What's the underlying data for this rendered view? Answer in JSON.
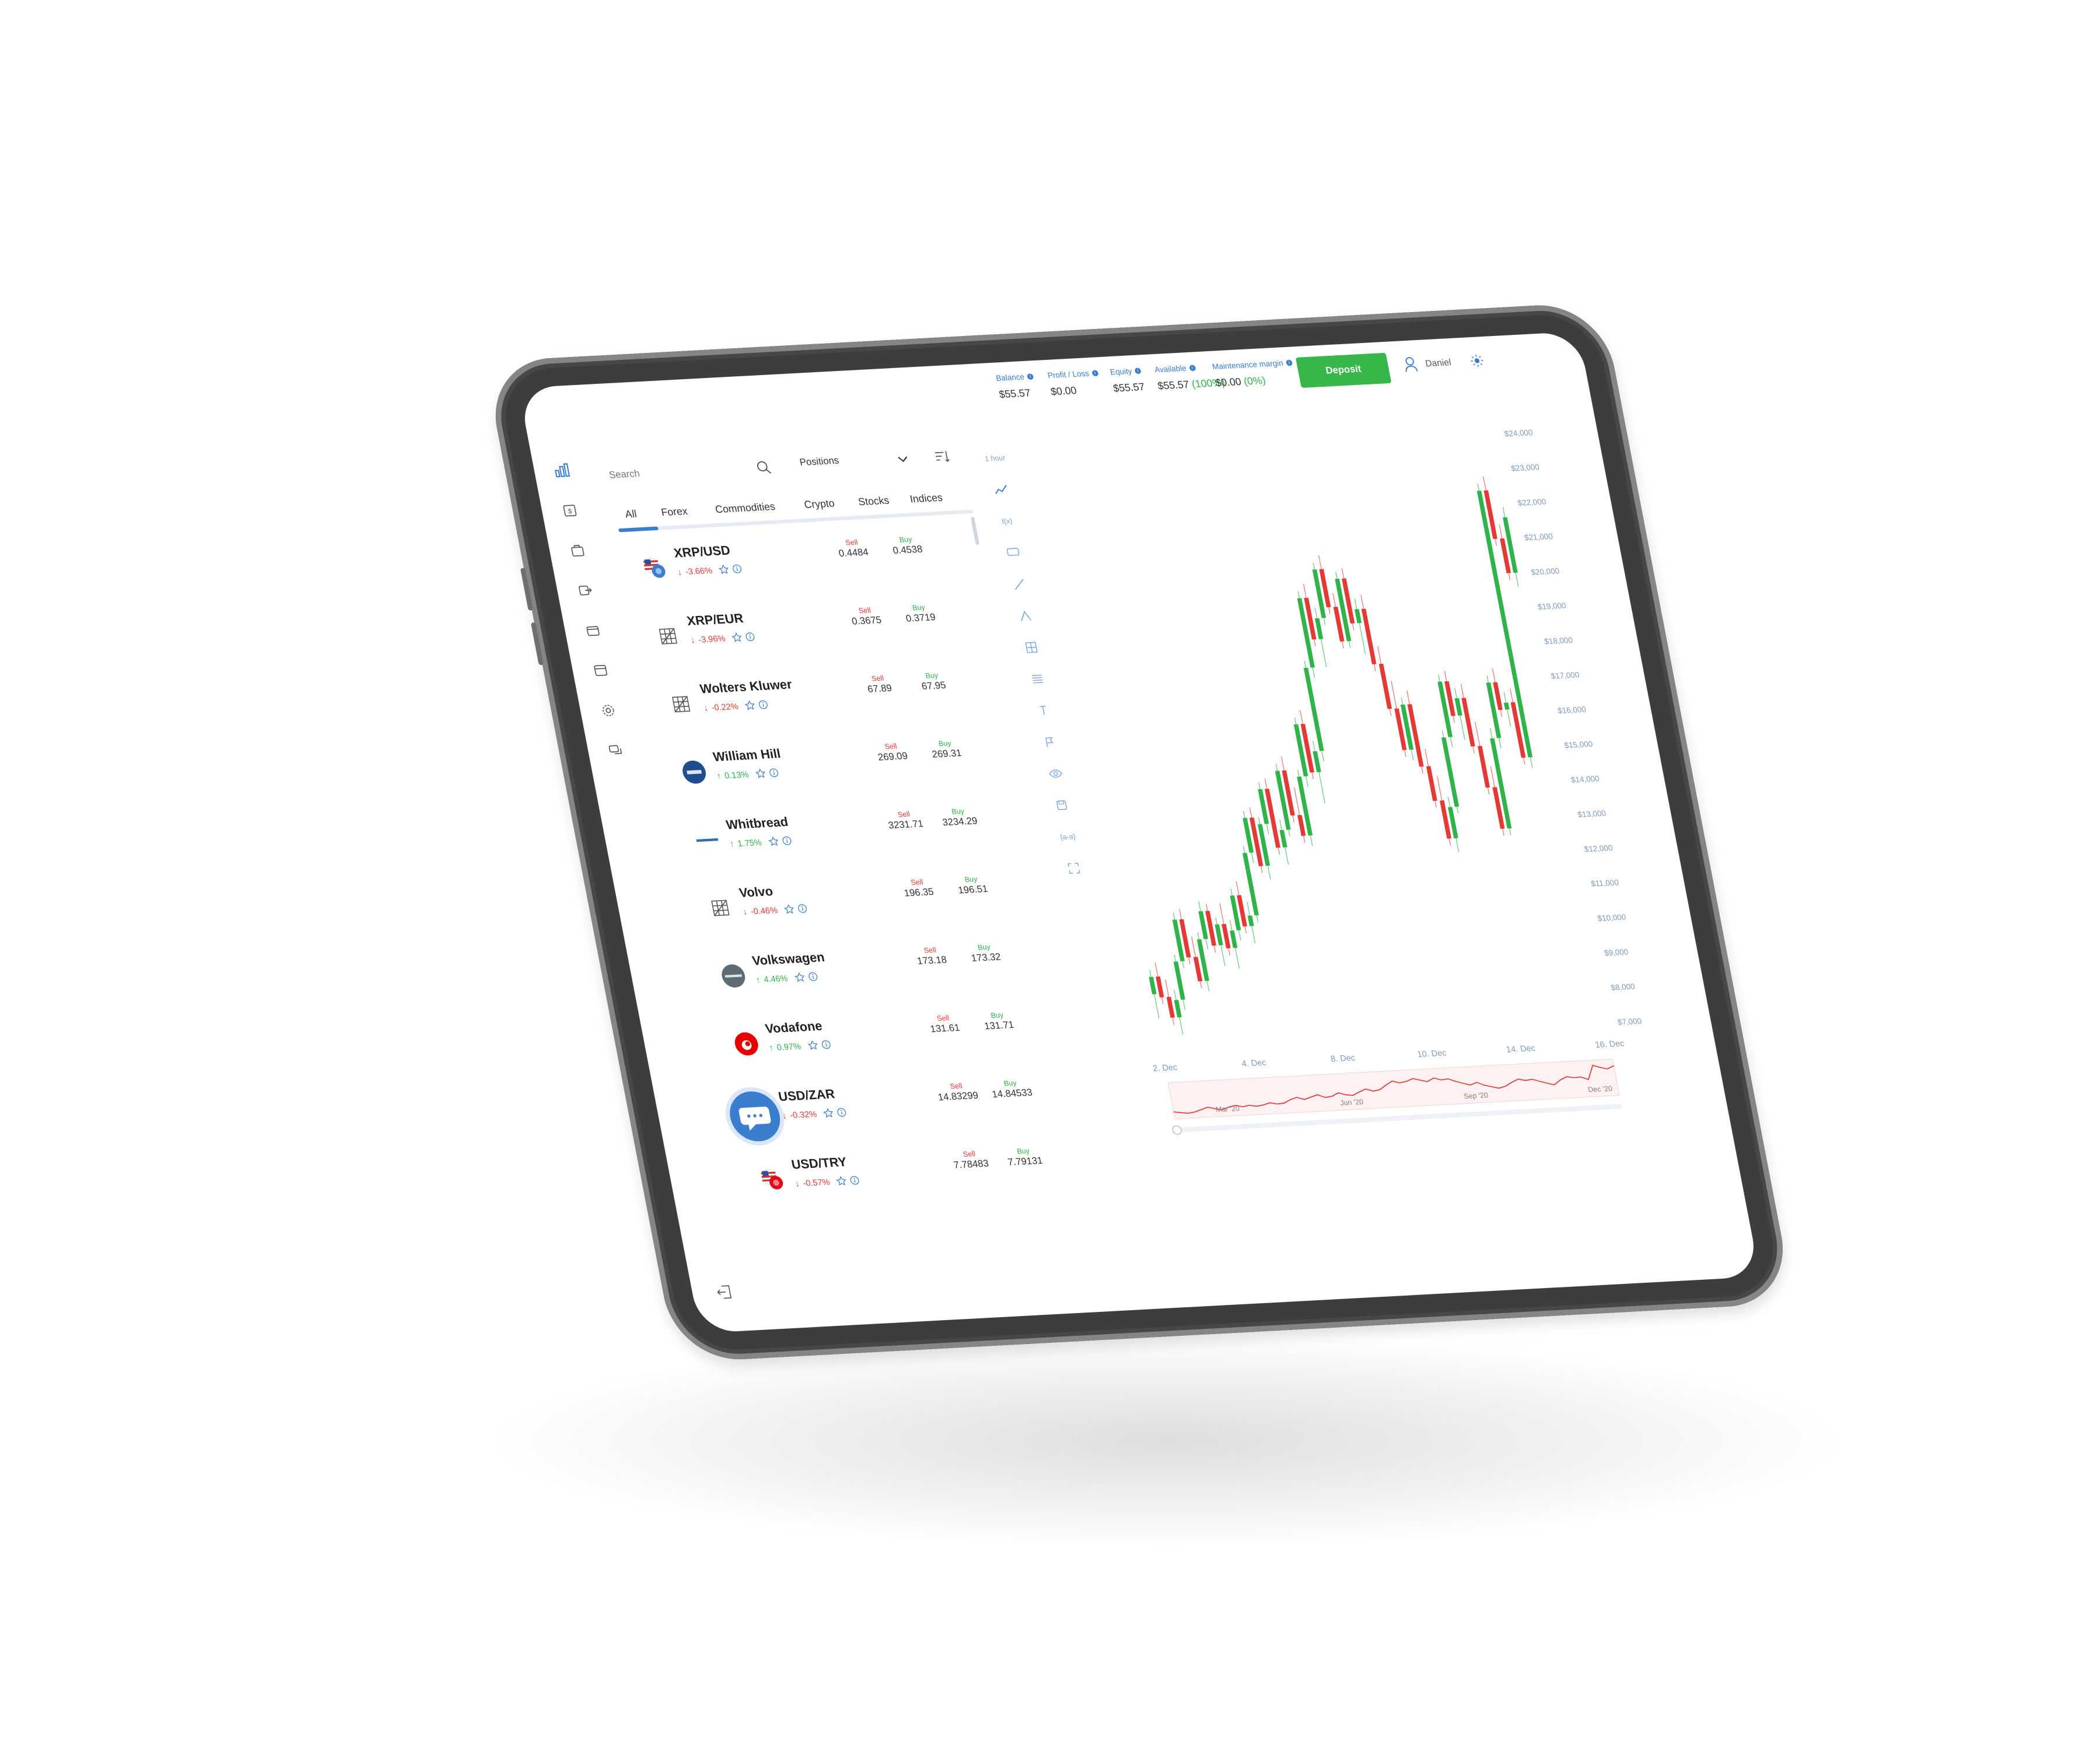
{
  "topbar": {
    "stats": [
      {
        "label": "Balance",
        "value": "$55.57"
      },
      {
        "label": "Profit / Loss",
        "value": "$0.00"
      },
      {
        "label": "Equity",
        "value": "$55.57"
      },
      {
        "label": "Available",
        "value": "$55.57",
        "extra": "(100%)"
      },
      {
        "label": "Maintenance margin",
        "value": "$0.00",
        "extra": "(0%)"
      }
    ],
    "deposit_label": "Deposit",
    "user_name": "Daniel"
  },
  "search": {
    "placeholder": "Search"
  },
  "positions_select": "Positions",
  "tabs": [
    "All",
    "Forex",
    "Commodities",
    "Crypto",
    "Stocks",
    "Indices"
  ],
  "active_tab": "All",
  "quote_labels": {
    "sell": "Sell",
    "buy": "Buy"
  },
  "instruments": [
    {
      "name": "XRP/USD",
      "change": "-3.66%",
      "direction": "down",
      "sell": "0.4484",
      "buy": "0.4538",
      "icon": "flag-us-xrp-icon"
    },
    {
      "name": "XRP/EUR",
      "change": "-3.96%",
      "direction": "down",
      "sell": "0.3675",
      "buy": "0.3719",
      "icon": "grid-placeholder-icon"
    },
    {
      "name": "Wolters Kluwer",
      "change": "-0.22%",
      "direction": "down",
      "sell": "67.89",
      "buy": "67.95",
      "icon": "grid-placeholder-icon"
    },
    {
      "name": "William Hill",
      "change": "0.13%",
      "direction": "up",
      "sell": "269.09",
      "buy": "269.31",
      "icon": "william-hill-logo"
    },
    {
      "name": "Whitbread",
      "change": "1.75%",
      "direction": "up",
      "sell": "3231.71",
      "buy": "3234.29",
      "icon": "whitbread-logo"
    },
    {
      "name": "Volvo",
      "change": "-0.46%",
      "direction": "down",
      "sell": "196.35",
      "buy": "196.51",
      "icon": "grid-placeholder-icon"
    },
    {
      "name": "Volkswagen",
      "change": "4.46%",
      "direction": "up",
      "sell": "173.18",
      "buy": "173.32",
      "icon": "volkswagen-logo"
    },
    {
      "name": "Vodafone",
      "change": "0.97%",
      "direction": "up",
      "sell": "131.61",
      "buy": "131.71",
      "icon": "vodafone-logo"
    },
    {
      "name": "USD/ZAR",
      "change": "-0.32%",
      "direction": "down",
      "sell": "14.83299",
      "buy": "14.84533",
      "icon": "flag-us-za-icon"
    },
    {
      "name": "USD/TRY",
      "change": "-0.57%",
      "direction": "down",
      "sell": "7.78483",
      "buy": "7.79131",
      "icon": "flag-us-tr-icon"
    }
  ],
  "chart_tools": {
    "interval": "1 hour",
    "fx_label": "f(x)",
    "compare_label": "{a-a}"
  },
  "chart_data": {
    "type": "candlestick",
    "interval": "1 hour",
    "y_ticks": [
      "$24,000",
      "$23,000",
      "$22,000",
      "$21,000",
      "$20,000",
      "$19,000",
      "$18,000",
      "$17,000",
      "$16,000",
      "$15,000",
      "$14,000",
      "$13,000",
      "$12,000",
      "$11,000",
      "$10,000",
      "$9,000",
      "$8,000",
      "$7,000"
    ],
    "x_ticks": [
      "2. Dec",
      "4. Dec",
      "8. Dec",
      "10. Dec",
      "14. Dec",
      "16. Dec"
    ],
    "navigator_ticks": [
      "Mar '20",
      "Jun '20",
      "Sep '20",
      "Dec '20"
    ],
    "ylim": [
      7000,
      24000
    ],
    "up_color": "#2fb34a",
    "down_color": "#e53935",
    "candles": [
      [
        8500,
        9200,
        7800,
        9000
      ],
      [
        9000,
        9400,
        8200,
        8400
      ],
      [
        8400,
        8900,
        7600,
        7800
      ],
      [
        7800,
        8600,
        7300,
        8300
      ],
      [
        8300,
        9600,
        8000,
        9400
      ],
      [
        9400,
        10800,
        9200,
        10600
      ],
      [
        10600,
        10900,
        9300,
        9500
      ],
      [
        9500,
        10100,
        8600,
        8800
      ],
      [
        8800,
        10200,
        8500,
        10000
      ],
      [
        10000,
        11100,
        9700,
        10800
      ],
      [
        10800,
        11000,
        9600,
        9800
      ],
      [
        9800,
        10600,
        9200,
        10400
      ],
      [
        10400,
        11000,
        9500,
        9700
      ],
      [
        9700,
        10500,
        9100,
        10200
      ],
      [
        10200,
        11400,
        9900,
        11200
      ],
      [
        11200,
        11600,
        10100,
        10300
      ],
      [
        10300,
        11000,
        9800,
        10600
      ],
      [
        10600,
        12600,
        10400,
        12400
      ],
      [
        12400,
        13600,
        12100,
        13400
      ],
      [
        13400,
        13700,
        11800,
        12000
      ],
      [
        12000,
        13400,
        11600,
        13200
      ],
      [
        13200,
        14400,
        12900,
        14200
      ],
      [
        14200,
        14500,
        12300,
        12500
      ],
      [
        12500,
        13300,
        12000,
        13000
      ],
      [
        13000,
        14900,
        12800,
        14700
      ],
      [
        14700,
        15100,
        13200,
        13400
      ],
      [
        13400,
        14200,
        12600,
        12800
      ],
      [
        12800,
        14700,
        12500,
        14500
      ],
      [
        14500,
        16200,
        14200,
        16000
      ],
      [
        16000,
        16400,
        14400,
        14600
      ],
      [
        14600,
        15500,
        13700,
        15200
      ],
      [
        15200,
        17800,
        14900,
        17600
      ],
      [
        17600,
        19800,
        17300,
        19600
      ],
      [
        19600,
        20000,
        18200,
        18400
      ],
      [
        18400,
        19300,
        17600,
        19000
      ],
      [
        19000,
        20600,
        18800,
        20400
      ],
      [
        20400,
        20800,
        19100,
        19300
      ],
      [
        19300,
        19700,
        18100,
        18300
      ],
      [
        18300,
        20300,
        18100,
        20100
      ],
      [
        20100,
        20400,
        18600,
        18800
      ],
      [
        18800,
        19500,
        17900,
        19200
      ],
      [
        19200,
        19600,
        17400,
        17600
      ],
      [
        17600,
        18100,
        16100,
        16300
      ],
      [
        16300,
        17100,
        14900,
        15100
      ],
      [
        15100,
        16600,
        14800,
        16400
      ],
      [
        16400,
        16800,
        14400,
        14600
      ],
      [
        14600,
        15100,
        13400,
        13600
      ],
      [
        13600,
        14300,
        12300,
        12500
      ],
      [
        12500,
        13700,
        12100,
        13400
      ],
      [
        13400,
        15600,
        13200,
        15400
      ],
      [
        15400,
        17200,
        15100,
        17000
      ],
      [
        17000,
        17300,
        15800,
        16000
      ],
      [
        16000,
        16800,
        15300,
        16500
      ],
      [
        16500,
        16900,
        14900,
        15100
      ],
      [
        15100,
        15800,
        13700,
        13900
      ],
      [
        13900,
        14500,
        12500,
        12700
      ],
      [
        12700,
        15600,
        12500,
        15300
      ],
      [
        15300,
        17100,
        15000,
        16900
      ],
      [
        16900,
        17300,
        15900,
        16100
      ],
      [
        16100,
        16600,
        15600,
        16300
      ],
      [
        16300,
        16700,
        14500,
        14700
      ],
      [
        14700,
        22600,
        14400,
        22400
      ],
      [
        22400,
        22800,
        20800,
        21000
      ],
      [
        21000,
        21400,
        19800,
        20000
      ],
      [
        20000,
        21900,
        19600,
        21600
      ]
    ]
  }
}
